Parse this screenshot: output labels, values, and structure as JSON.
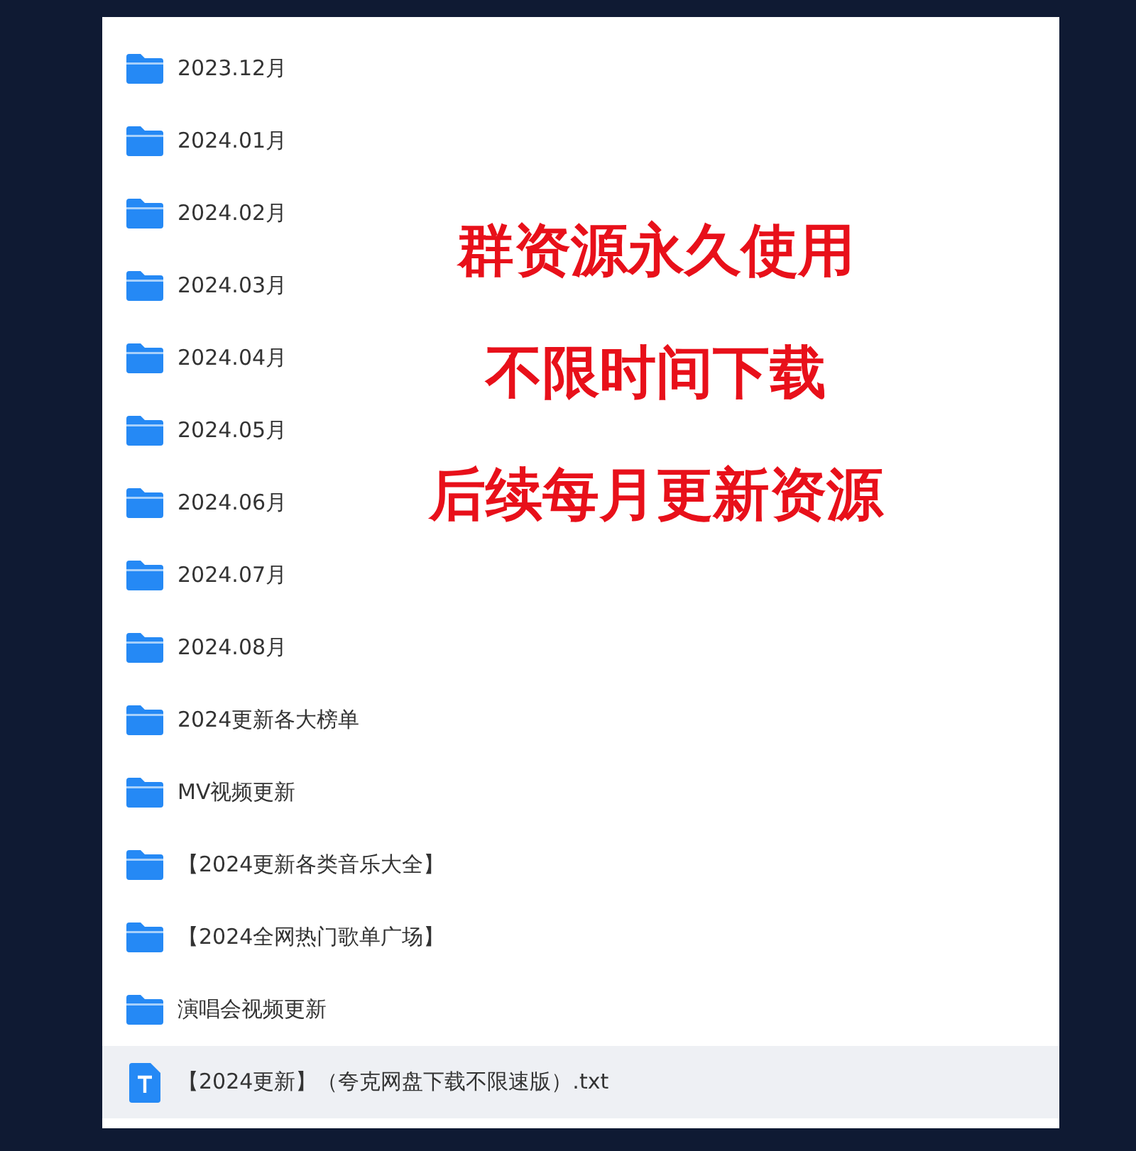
{
  "files": [
    {
      "name": "2023.12月",
      "kind": "folder",
      "selected": false
    },
    {
      "name": "2024.01月",
      "kind": "folder",
      "selected": false
    },
    {
      "name": "2024.02月",
      "kind": "folder",
      "selected": false
    },
    {
      "name": "2024.03月",
      "kind": "folder",
      "selected": false
    },
    {
      "name": "2024.04月",
      "kind": "folder",
      "selected": false
    },
    {
      "name": "2024.05月",
      "kind": "folder",
      "selected": false
    },
    {
      "name": "2024.06月",
      "kind": "folder",
      "selected": false
    },
    {
      "name": "2024.07月",
      "kind": "folder",
      "selected": false
    },
    {
      "name": "2024.08月",
      "kind": "folder",
      "selected": false
    },
    {
      "name": "2024更新各大榜单",
      "kind": "folder",
      "selected": false
    },
    {
      "name": "MV视频更新",
      "kind": "folder",
      "selected": false
    },
    {
      "name": "【2024更新各类音乐大全】",
      "kind": "folder",
      "selected": false
    },
    {
      "name": "【2024全网热门歌单广场】",
      "kind": "folder",
      "selected": false
    },
    {
      "name": "演唱会视频更新",
      "kind": "folder",
      "selected": false
    },
    {
      "name": "【2024更新】（夸克网盘下载不限速版）.txt",
      "kind": "text-file",
      "selected": true
    }
  ],
  "promo_lines": [
    "群资源永久使用",
    "不限时间下载",
    "后续每月更新资源"
  ]
}
